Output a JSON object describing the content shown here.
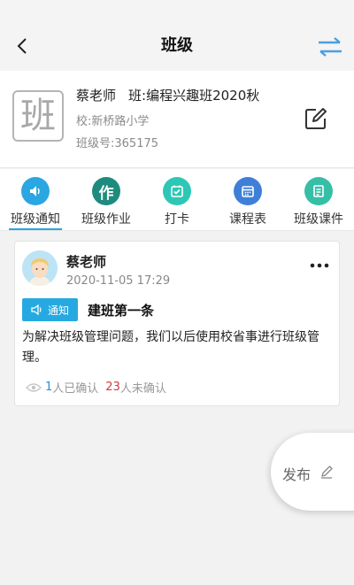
{
  "header": {
    "title": "班级",
    "back_icon": "chevron-left-icon",
    "switch_icon": "swap-arrows-icon",
    "switch_color": "#4a9fe0"
  },
  "class_info": {
    "avatar_char": "班",
    "teacher": "蔡老师",
    "class_name": "班:编程兴趣班2020秋",
    "school": "校:新桥路小学",
    "class_number": "班级号:365175",
    "edit_icon": "edit-icon"
  },
  "tabs": [
    {
      "label": "班级通知",
      "icon": "speaker-icon",
      "color": "#2aa6e3",
      "active": true
    },
    {
      "label": "班级作业",
      "icon": "homework-icon",
      "color": "#1f8b7e",
      "active": false
    },
    {
      "label": "打卡",
      "icon": "checkin-icon",
      "color": "#2ec7b5",
      "active": false
    },
    {
      "label": "课程表",
      "icon": "calendar-icon",
      "color": "#3f7fd8",
      "active": false
    },
    {
      "label": "班级课件",
      "icon": "courseware-icon",
      "color": "#36bfa6",
      "active": false
    }
  ],
  "post": {
    "author": "蔡老师",
    "time": "2020-11-05 17:29",
    "badge": "通知",
    "title": "建班第一条",
    "body": "为解决班级管理问题，我们以后使用校省事进行班级管理。",
    "confirmed_count": "1",
    "confirmed_label": "人已确认",
    "unconfirmed_count": "23",
    "unconfirmed_label": "人未确认",
    "badge_color": "#26a9e0"
  },
  "publish": {
    "label": "发布",
    "icon": "pencil-icon"
  }
}
